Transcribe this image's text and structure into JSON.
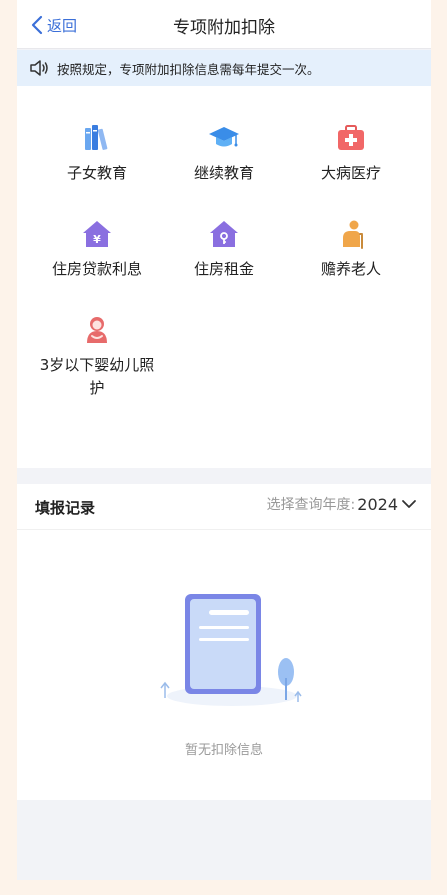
{
  "nav": {
    "back_label": "返回",
    "title": "专项附加扣除"
  },
  "notice": {
    "text": "按照规定，专项附加扣除信息需每年提交一次。"
  },
  "categories": [
    {
      "label": "子女教育",
      "icon": "books-icon"
    },
    {
      "label": "继续教育",
      "icon": "graduation-cap-icon"
    },
    {
      "label": "大病医疗",
      "icon": "medical-kit-icon"
    },
    {
      "label": "住房贷款利息",
      "icon": "house-yuan-icon"
    },
    {
      "label": "住房租金",
      "icon": "house-key-icon"
    },
    {
      "label": "赡养老人",
      "icon": "elderly-person-icon"
    },
    {
      "label_line1": "3岁以下婴幼儿照",
      "label_line2": "护",
      "icon": "infant-care-icon"
    }
  ],
  "records": {
    "title": "填报记录",
    "year_label": "选择查询年度:",
    "year_value": "2024",
    "empty_text": "暂无扣除信息"
  },
  "colors": {
    "accent": "#3b6fd8",
    "notice_bg": "#e5f0fc",
    "page_bg": "#f2f3f7"
  }
}
